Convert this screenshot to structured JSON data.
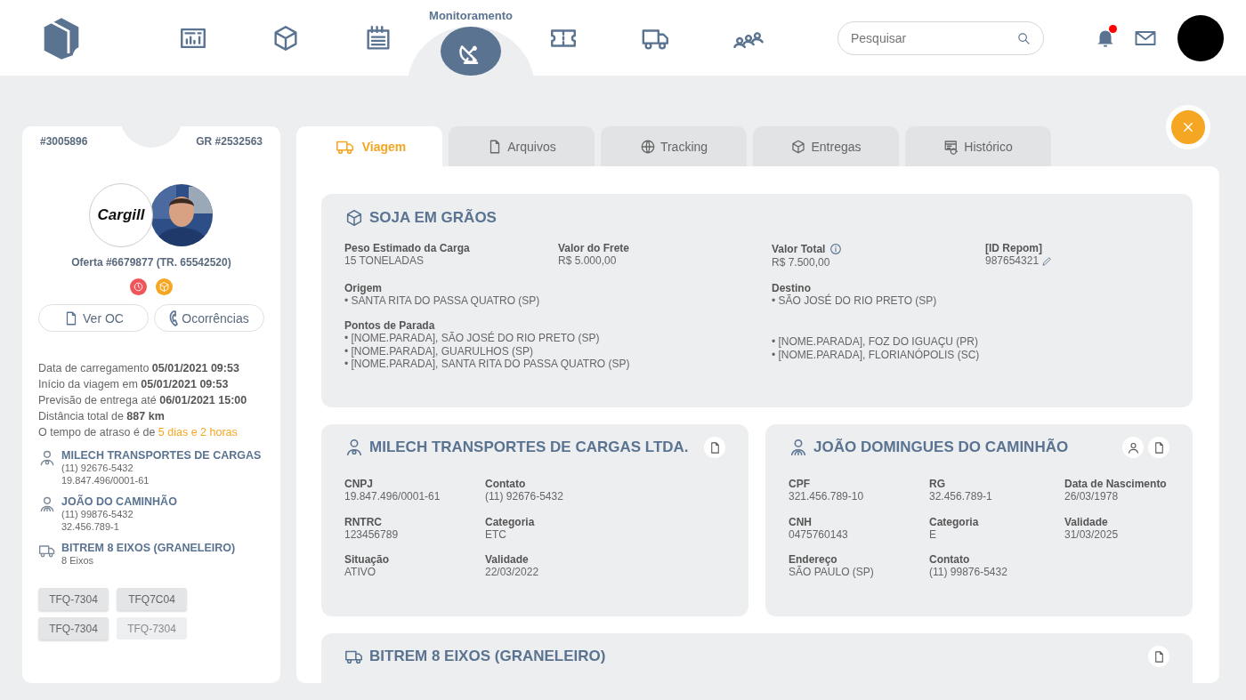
{
  "nav": {
    "items": [
      {
        "selected": false
      },
      {
        "selected": false
      },
      {
        "selected": false
      },
      {
        "label": "Monitoramento",
        "selected": true
      },
      {
        "selected": false
      },
      {
        "selected": false
      },
      {
        "selected": false
      }
    ],
    "search": {
      "placeholder": "Pesquisar"
    },
    "notifications": {
      "unread": true
    }
  },
  "summary": {
    "id": "#3005896",
    "gr": "GR #2532563",
    "shipper_logo": "Cargill",
    "offer": "Oferta #6679877 (TR. 65542520)",
    "status_icons": [
      {
        "kind": "clock",
        "color": "#f0555a"
      },
      {
        "kind": "box",
        "color": "#f5a623"
      }
    ],
    "buttons": [
      "Ver OC",
      "Ocorrências"
    ],
    "info": [
      {
        "label": "Data de carregamento",
        "value": "05/01/2021 09:53",
        "kind": "bold"
      },
      {
        "label": "Início da viagem em",
        "value": "05/01/2021 09:53",
        "kind": "bold"
      },
      {
        "label": "Previsão de entrega até",
        "value": "06/01/2021 15:00",
        "kind": "bold"
      },
      {
        "label": "Distância total de",
        "value": "887 km",
        "kind": "bold"
      },
      {
        "label": "O tempo de atraso é de",
        "value": "5 dias e 2 horas",
        "kind": "alert"
      }
    ],
    "contacts": [
      {
        "kind": "company",
        "title": "MILECH TRANSPORTES DE CARGAS",
        "lines": [
          "(11) 92676-5432",
          "19.847.496/0001-61"
        ]
      },
      {
        "kind": "driver",
        "title": "JOÃO DO CAMINHÃO",
        "lines": [
          "(11) 99876-5432",
          "32.456.789-1"
        ]
      },
      {
        "kind": "vehicle",
        "title": "BITREM 8 EIXOS (GRANELEIRO)",
        "lines": [
          "8 Eixos"
        ]
      }
    ],
    "plates": [
      {
        "text": "TFQ-7304",
        "faded": false
      },
      {
        "text": "TFQ7C04",
        "faded": false
      },
      {
        "text": "TFQ-7304",
        "faded": false
      },
      {
        "text": "TFQ-7304",
        "faded": true
      }
    ]
  },
  "tabs": [
    {
      "label": "Viagem",
      "selected": true
    },
    {
      "label": "Arquivos",
      "selected": false
    },
    {
      "label": "Tracking",
      "selected": false
    },
    {
      "label": "Entregas",
      "selected": false
    },
    {
      "label": "Histórico",
      "selected": false
    }
  ],
  "cargo": {
    "title": "SOJA EM GRÃOS",
    "fields": [
      {
        "label": "Peso Estimado da Carga",
        "value": "15 TONELADAS"
      },
      {
        "label": "Valor do Frete",
        "value": "R$ 5.000,00"
      },
      {
        "label": "Valor Total",
        "value": "R$ 7.500,00"
      },
      {
        "label": "[ID Repom]",
        "value": "987654321"
      }
    ],
    "route": [
      {
        "label": "Origem",
        "items": [
          "• SANTA RITA DO PASSA QUATRO (SP)"
        ]
      },
      {
        "label": "Destino",
        "items": [
          "• SÃO JOSÉ DO RIO PRETO (SP)"
        ]
      }
    ],
    "stops": {
      "label": "Pontos de Parada",
      "items_left": [
        "• [NOME.PARADA], SÃO JOSÉ DO RIO PRETO (SP)",
        "• [NOME.PARADA], GUARULHOS (SP)",
        "• [NOME.PARADA], SANTA RITA DO PASSA QUATRO (SP)"
      ],
      "items_right": [
        "• [NOME.PARADA], FOZ DO IGUAÇU (PR)",
        "• [NOME.PARADA], FLORIANÓPOLIS (SC)"
      ]
    }
  },
  "parties": [
    {
      "kind": "company",
      "title": "MILECH TRANSPORTES DE CARGAS LTDA.",
      "rows": [
        [
          {
            "label": "CNPJ",
            "value": "19.847.496/0001-61"
          },
          {
            "label": "Contato",
            "value": "(11) 92676-5432"
          }
        ],
        [
          {
            "label": "RNTRC",
            "value": "123456789"
          },
          {
            "label": "Categoria",
            "value": "ETC"
          }
        ],
        [
          {
            "label": "Situação",
            "value": "ATIVO"
          },
          {
            "label": "Validade",
            "value": "22/03/2022"
          }
        ]
      ]
    },
    {
      "kind": "driver",
      "title": "JOÃO DOMINGUES DO CAMINHÃO",
      "rows": [
        [
          {
            "label": "CPF",
            "value": "321.456.789-10"
          },
          {
            "label": "RG",
            "value": "32.456.789-1"
          },
          {
            "label": "Data de Nascimento",
            "value": "26/03/1978"
          }
        ],
        [
          {
            "label": "CNH",
            "value": "0475760143"
          },
          {
            "label": "Categoria",
            "value": "E"
          },
          {
            "label": "Validade",
            "value": "31/03/2025"
          }
        ],
        [
          {
            "label": "Endereço",
            "value": "SÃO PAULO (SP)"
          },
          {
            "label": "Contato",
            "value": "(11) 99876-5432"
          }
        ]
      ]
    }
  ],
  "vehicle": {
    "title": "BITREM 8 EIXOS (GRANELEIRO)"
  }
}
